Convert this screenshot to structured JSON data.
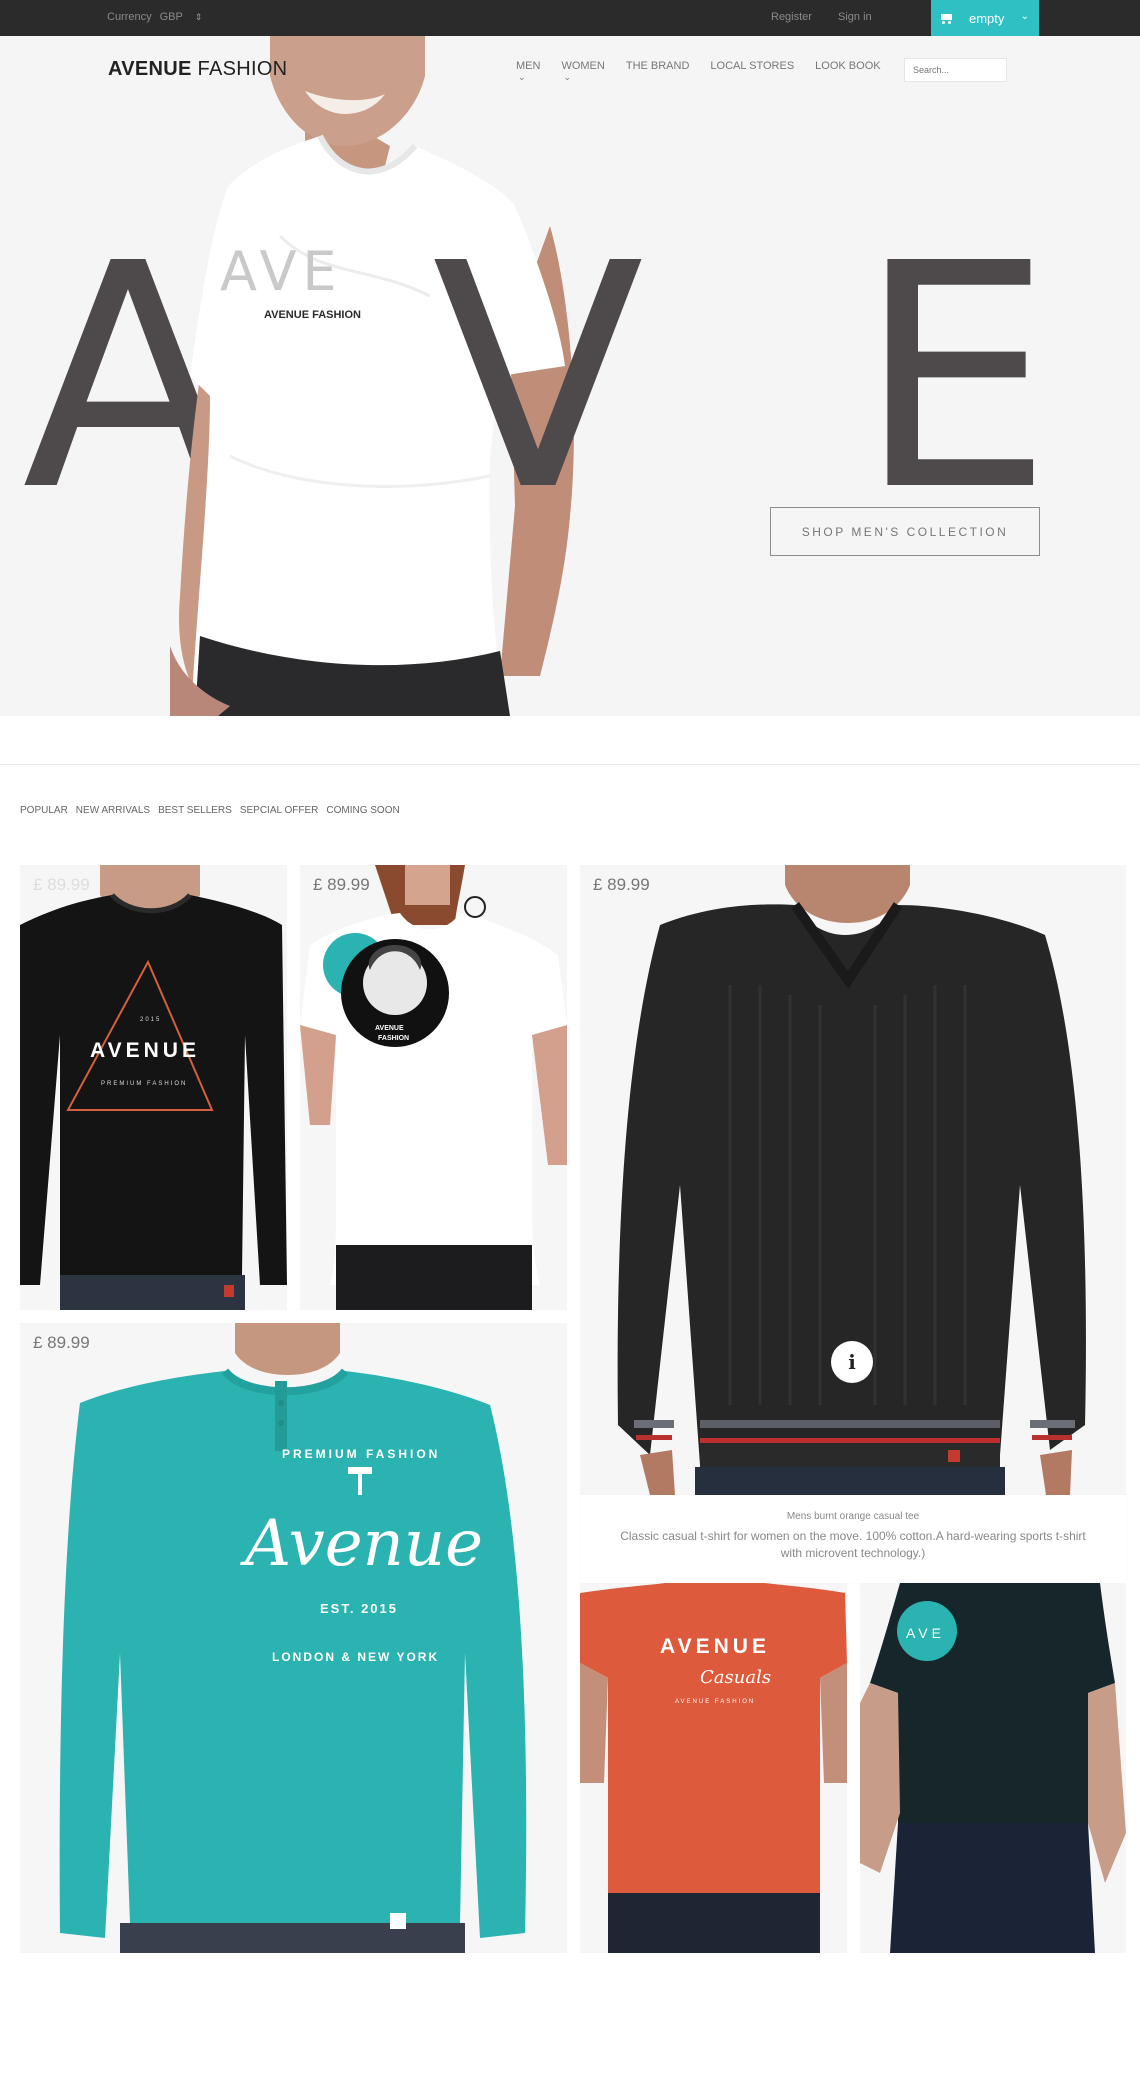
{
  "topbar": {
    "currency_label": "Currency",
    "currency_value": "GBP",
    "register": "Register",
    "signin": "Sign in",
    "cart_label": "empty",
    "accent": "#2fc0c4"
  },
  "header": {
    "logo_bold": "AVENUE",
    "logo_light": "FASHION",
    "nav": [
      "MEN",
      "WOMEN",
      "THE BRAND",
      "LOCAL STORES",
      "LOOK BOOK"
    ],
    "search_placeholder": "Search..."
  },
  "hero": {
    "letters": [
      "A",
      "V",
      "E"
    ],
    "shirt_letters": "AVE",
    "shirt_text": "AVENUE FASHION",
    "cta": "SHOP MEN'S COLLECTION"
  },
  "filters": [
    "POPULAR",
    "NEW ARRIVALS",
    "BEST SELLERS",
    "SEPCIAL OFFER",
    "COMING SOON"
  ],
  "products": [
    {
      "price": "£ 89.99",
      "print_top": "2015",
      "print_main": "AVENUE",
      "print_sub": "PREMIUM FASHION"
    },
    {
      "price": "£ 89.99",
      "print_main": "AVENUE",
      "print_sub": "FASHION"
    },
    {
      "price": "£ 89.99"
    },
    {
      "price": "£ 89.99",
      "print_top": "PREMIUM FASHION",
      "print_main": "Avenue",
      "print_est": "EST. 2015",
      "print_bottom": "LONDON & NEW YORK"
    },
    {
      "print_main": "AVENUE",
      "print_sub": "Casuals",
      "print_small": "AVENUE FASHION"
    },
    {
      "print_main": "AVE"
    }
  ],
  "info_panel": {
    "title": "Mens burnt orange casual tee",
    "desc": "Classic casual t-shirt for women on the move. 100% cotton.A hard-wearing sports t-shirt with microvent technology.)"
  },
  "colors": {
    "letter": "#4e4a4b",
    "teal": "#2ab3b0",
    "orange": "#dd5b3c",
    "dark_shirt": "#141414",
    "navy_shirt": "#16262a"
  }
}
